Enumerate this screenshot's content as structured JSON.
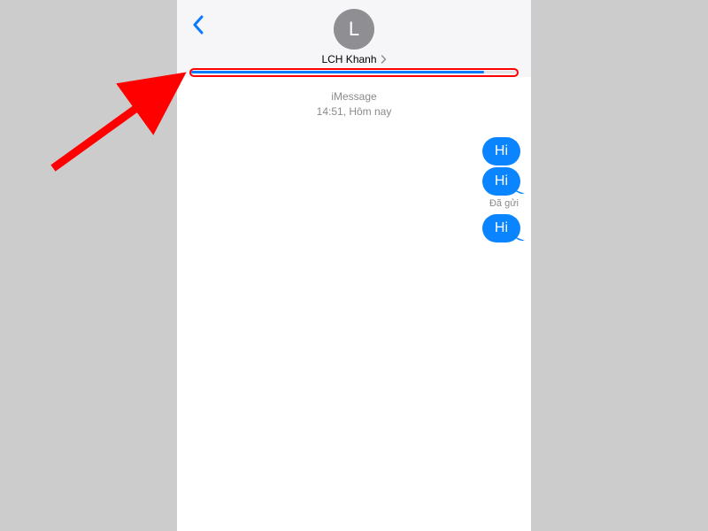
{
  "header": {
    "avatar_initial": "L",
    "contact_name": "LCH Khanh"
  },
  "progress": {
    "percent": 90
  },
  "thread": {
    "service_label": "iMessage",
    "timestamp": "14:51, Hôm nay"
  },
  "messages": [
    {
      "text": "Hi",
      "outgoing": true,
      "tail": false
    },
    {
      "text": "Hi",
      "outgoing": true,
      "tail": true
    },
    {
      "text": "Hi",
      "outgoing": true,
      "tail": true
    }
  ],
  "status_after_index": 1,
  "status_label": "Đã gửi",
  "colors": {
    "ios_blue": "#0a84ff",
    "annotation_red": "#ff0000"
  }
}
